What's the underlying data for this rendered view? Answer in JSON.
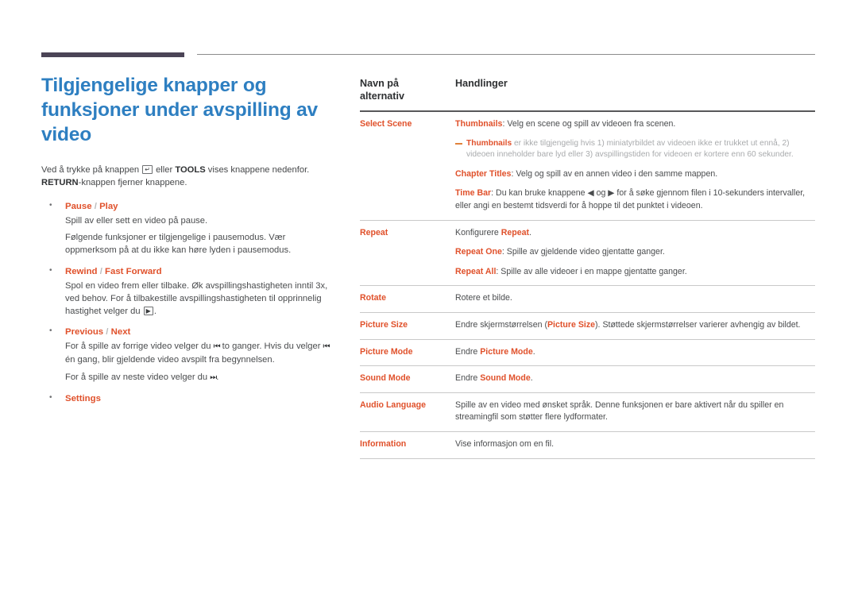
{
  "document": {
    "title": "Tilgjengelige knapper og funksjoner under avspilling av video",
    "intro_prefix": "Ved å trykke på knappen",
    "intro_mid": "eller",
    "intro_tools": "TOOLS",
    "intro_after": "vises knappene nedenfor.",
    "intro_return": "RETURN",
    "intro_end": "-knappen fjerner knappene.",
    "icons": {
      "enter_key": "enter-key-icon",
      "play": "play-icon",
      "skip_back": "skip-back-icon",
      "skip_forward": "skip-forward-icon",
      "seek_left": "seek-left-icon",
      "seek_right": "seek-right-icon"
    }
  },
  "bullets": [
    {
      "head_a": "Pause",
      "head_sep": "/",
      "head_b": "Play",
      "lines": [
        "Spill av eller sett en video på pause.",
        "Følgende funksjoner er tilgjengelige i pausemodus. Vær oppmerksom på at du ikke kan høre lyden i pausemodus."
      ]
    },
    {
      "head_a": "Rewind",
      "head_sep": "/",
      "head_b": "Fast Forward",
      "lines": [
        "Spol en video frem eller tilbake. Øk avspillingshastigheten inntil 3x, ved behov. For å tilbakestille avspillingshastigheten til opprinnelig hastighet velger du",
        "."
      ]
    },
    {
      "head_a": "Previous",
      "head_sep": "/",
      "head_b": "Next",
      "lines": [
        "For å spille av forrige video velger du",
        "to ganger. Hvis du velger",
        "én gang, blir gjeldende video avspilt fra begynnelsen.",
        "For å spille av neste video velger du",
        "."
      ]
    },
    {
      "head_a": "Settings",
      "head_sep": "",
      "head_b": "",
      "lines": []
    }
  ],
  "table": {
    "headers": {
      "col1_line1": "Navn på",
      "col1_line2": "alternativ",
      "col2": "Handlinger"
    },
    "rows": [
      {
        "name": "Select Scene",
        "paras": [
          {
            "bold": "Thumbnails",
            "text": ": Velg en scene og spill av videoen fra scenen."
          },
          {
            "bold": "Chapter Titles",
            "text": ": Velg og spill av en annen video i den samme mappen."
          },
          {
            "bold": "Time Bar",
            "text": ": Du kan bruke knappene ◀ og ▶ for å søke gjennom filen i 10-sekunders intervaller, eller angi en bestemt tidsverdi for å hoppe til det punktet i videoen."
          }
        ],
        "note": {
          "bold": "Thumbnails",
          "text": " er ikke tilgjengelig hvis 1) miniatyrbildet av videoen ikke er trukket ut ennå, 2) videoen inneholder bare lyd eller 3) avspillingstiden for videoen er kortere enn 60 sekunder."
        }
      },
      {
        "name": "Repeat",
        "paras": [
          {
            "pre": "Konfigurere ",
            "bold": "Repeat",
            "text": "."
          },
          {
            "bold": "Repeat One",
            "text": ": Spille av gjeldende video gjentatte ganger."
          },
          {
            "bold": "Repeat All",
            "text": ": Spille av alle videoer i en mappe gjentatte ganger."
          }
        ]
      },
      {
        "name": "Rotate",
        "paras": [
          {
            "text": "Rotere et bilde."
          }
        ]
      },
      {
        "name": "Picture Size",
        "paras": [
          {
            "pre": "Endre skjermstørrelsen (",
            "bold": "Picture Size",
            "text": "). Støttede skjermstørrelser varierer avhengig av bildet."
          }
        ]
      },
      {
        "name": "Picture Mode",
        "paras": [
          {
            "pre": "Endre ",
            "bold": "Picture Mode",
            "text": "."
          }
        ]
      },
      {
        "name": "Sound Mode",
        "paras": [
          {
            "pre": "Endre ",
            "bold": "Sound Mode",
            "text": "."
          }
        ]
      },
      {
        "name": "Audio Language",
        "paras": [
          {
            "text": "Spille av en video med ønsket språk. Denne funksjonen er bare aktivert når du spiller en streamingfil som støtter flere lydformater."
          }
        ]
      },
      {
        "name": "Information",
        "paras": [
          {
            "text": "Vise informasjon om en fil."
          }
        ]
      }
    ]
  },
  "colors": {
    "accent_orange": "#e0512b",
    "title_blue": "#2e7fc1",
    "rule_dark": "#4b4456",
    "body_gray": "#4a4c4e",
    "note_gray": "#a9abad"
  }
}
